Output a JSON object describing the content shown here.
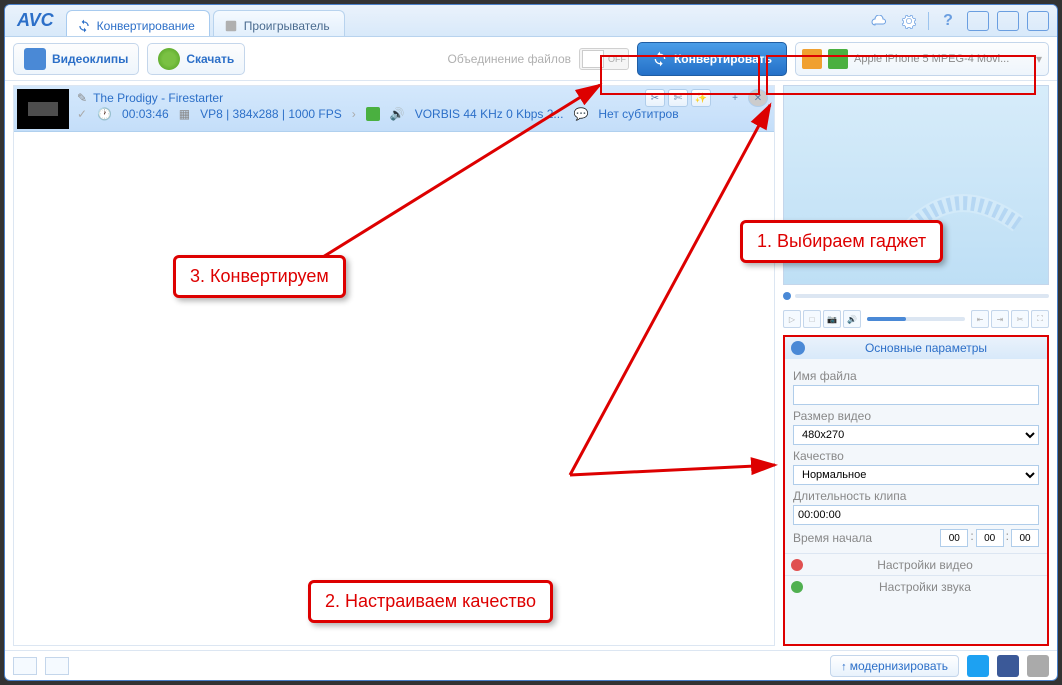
{
  "logo": "AVC",
  "tabs": {
    "convert": "Конвертирование",
    "player": "Проигрыватель"
  },
  "toolbar": {
    "videoclips": "Видеоклипы",
    "download": "Скачать",
    "merge": "Объединение файлов",
    "switch_off": "OFF",
    "convert": "Конвертировать",
    "profile": "Apple iPhone 5 MPEG-4 Movi..."
  },
  "clip": {
    "title": "The Prodigy - Firestarter",
    "duration": "00:03:46",
    "codec": "VP8 | 384x288 | 1000 FPS",
    "audio": "VORBIS 44 KHz 0 Kbps 2...",
    "subs": "Нет субтитров"
  },
  "panel": {
    "title": "Основные параметры",
    "file_label": "Имя файла",
    "file_value": "",
    "size_label": "Размер видео",
    "size_value": "480x270",
    "quality_label": "Качество",
    "quality_value": "Нормальное",
    "duration_label": "Длительность клипа",
    "duration_value": "00:00:00",
    "start_label": "Время начала",
    "start_h": "00",
    "start_m": "00",
    "start_s": "00",
    "video_settings": "Настройки видео",
    "audio_settings": "Настройки звука"
  },
  "status": {
    "upgrade": "модернизировать"
  },
  "annotations": {
    "a1": "1. Выбираем гаджет",
    "a2": "2. Настраиваем качество",
    "a3": "3. Конвертируем"
  }
}
